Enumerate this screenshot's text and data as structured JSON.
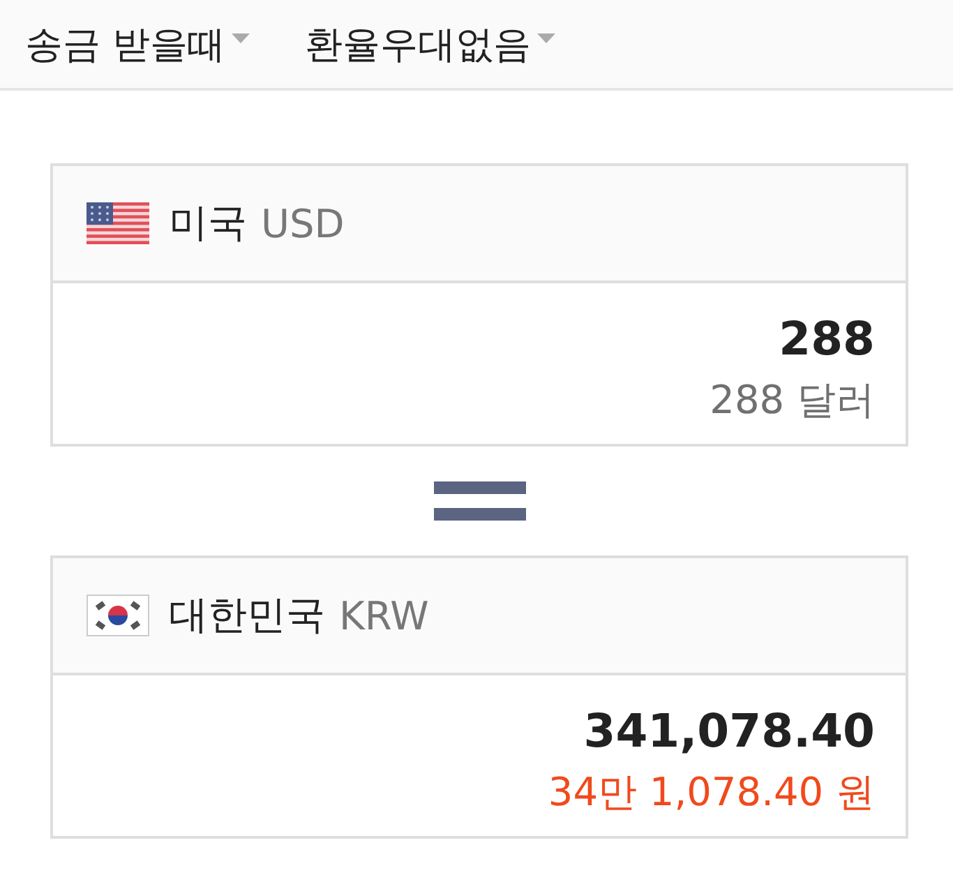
{
  "filters": [
    {
      "label": "송금 받을때"
    },
    {
      "label": "환율우대없음"
    }
  ],
  "cards": [
    {
      "kind": "us",
      "country": "미국",
      "code": "USD",
      "amount": "288",
      "reading": "288 달러",
      "color": "#707070"
    },
    {
      "kind": "kr",
      "country": "대한민국",
      "code": "KRW",
      "amount": "341,078.40",
      "reading": "34만 1,078.40 원",
      "color": "#f04a1c"
    }
  ]
}
